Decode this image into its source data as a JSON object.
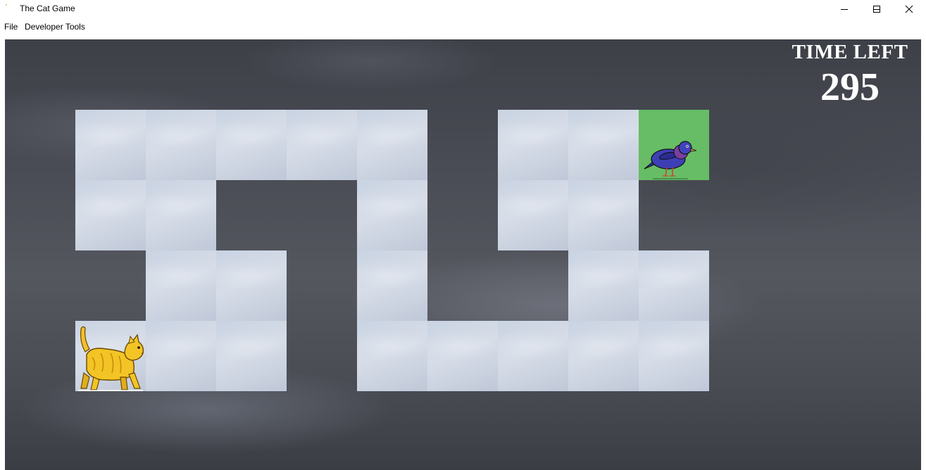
{
  "window": {
    "title": "The Cat Game",
    "controls": [
      "minimize-icon",
      "maximize-icon",
      "close-icon"
    ]
  },
  "menu": {
    "items": [
      "File",
      "Developer Tools"
    ]
  },
  "hud": {
    "time_label": "TIME LEFT",
    "time_value": "295"
  },
  "maze": {
    "path_color": "#d0d8e6",
    "goal_color": "#66bd65",
    "player": "cat-sprite",
    "goal": "bird-sprite"
  }
}
